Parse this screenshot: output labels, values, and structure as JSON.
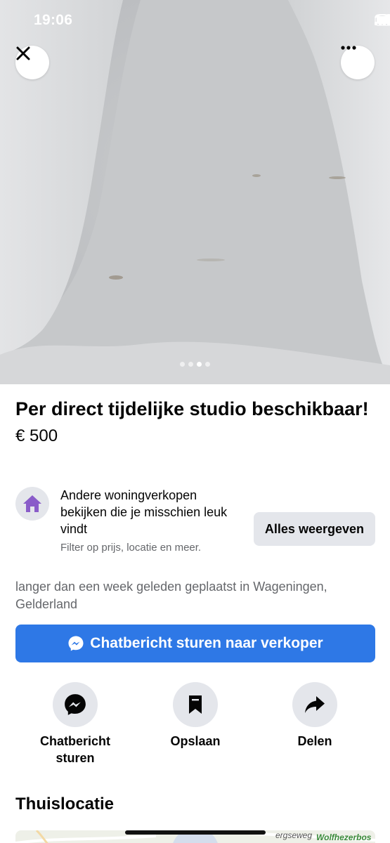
{
  "status_bar": {
    "time": "19:06"
  },
  "photo": {
    "page_count": 4,
    "active_index": 2
  },
  "listing": {
    "title": "Per direct tijdelijke studio beschikbaar!",
    "price": "€ 500"
  },
  "promo": {
    "icon": "house-icon",
    "heading": "Andere woningverkopen bekijken die je misschien leuk vindt",
    "subtext": "Filter op prijs, locatie en meer.",
    "button_label": "Alles weergeven"
  },
  "posted_text": "langer dan een week geleden geplaatst in Wageningen, Gelderland",
  "chat_button": {
    "label": "Chatbericht sturen naar verkoper",
    "icon": "messenger-icon"
  },
  "actions": [
    {
      "label": "Chatbericht sturen",
      "icon": "messenger-icon"
    },
    {
      "label": "Opslaan",
      "icon": "bookmark-icon"
    },
    {
      "label": "Delen",
      "icon": "share-icon"
    }
  ],
  "location": {
    "section_title": "Thuislocatie",
    "map_road": "ergseweg",
    "map_place": "Wolfhezerbos"
  },
  "colors": {
    "primary": "#2e78e6",
    "promo_icon": "#8a5cc9",
    "secondary_bg": "#e4e6eb"
  }
}
